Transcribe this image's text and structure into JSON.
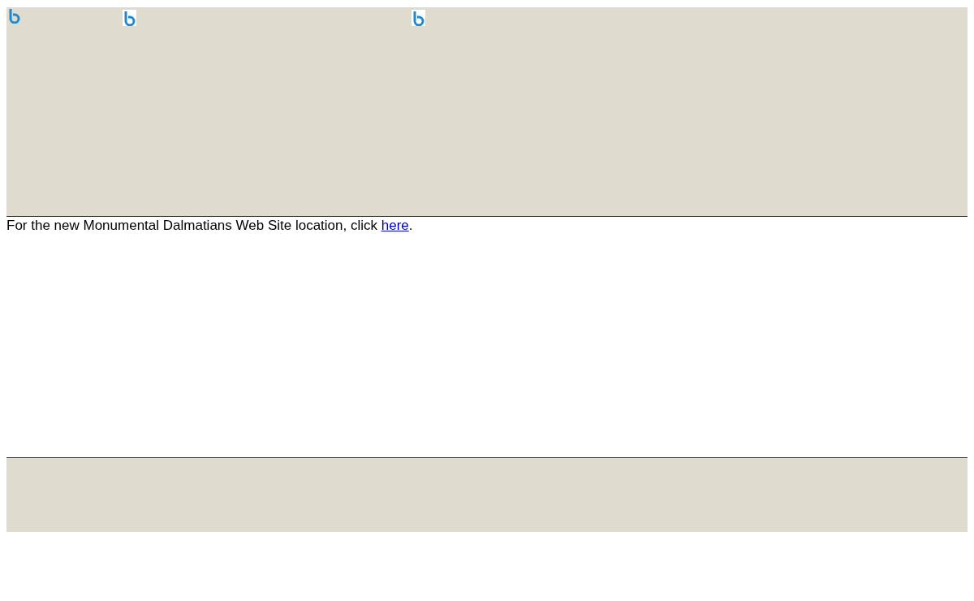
{
  "header": {
    "images": [
      {
        "kind": "plain"
      },
      {
        "kind": "framed"
      },
      {
        "kind": "framed"
      }
    ]
  },
  "notice": {
    "text_before": "For the new Monumental Dalmatians Web Site location, click ",
    "link": "here",
    "text_after": "."
  }
}
